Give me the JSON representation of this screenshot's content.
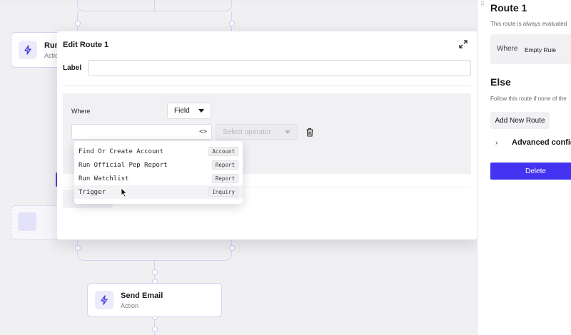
{
  "canvas": {
    "run_node": {
      "title": "Run",
      "subtitle": "Action"
    },
    "send_email_node": {
      "title": "Send Email",
      "subtitle": "Action"
    }
  },
  "modal": {
    "title": "Edit Route 1",
    "label_field": {
      "label": "Label",
      "value": "",
      "placeholder": ""
    },
    "rule": {
      "where_label": "Where",
      "field_selector": "Field",
      "operator_placeholder": "Select operator",
      "code_toggle": "<>"
    },
    "dropdown": [
      {
        "name": "Find Or Create Account",
        "tag": "Account"
      },
      {
        "name": "Run Official Pep Report",
        "tag": "Report"
      },
      {
        "name": "Run Watchlist",
        "tag": "Report"
      },
      {
        "name": "Trigger",
        "tag": "Inquiry"
      }
    ]
  },
  "panel": {
    "title": "Route 1",
    "subtitle": "This route is always evaluated",
    "where_label": "Where",
    "rule_text": "Empty Rule",
    "else_title": "Else",
    "else_subtitle": "Follow this route if none of the",
    "add_route_label": "Add New Route",
    "advanced_label": "Advanced config",
    "delete_label": "Delete"
  },
  "colors": {
    "accent": "#4433f0",
    "wire": "#d6d0f3",
    "node_border": "#d8d2f5"
  },
  "icons": [
    "bolt-icon",
    "expand-icon",
    "code-icon",
    "trash-icon",
    "chevron-right-icon",
    "drag-handle-icon",
    "cursor-icon"
  ]
}
